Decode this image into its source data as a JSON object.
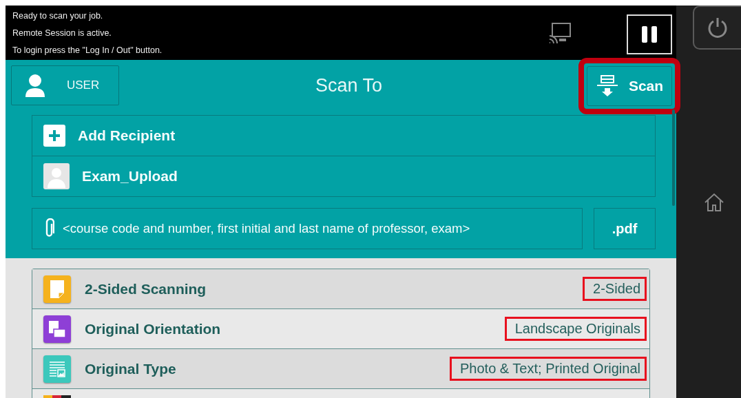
{
  "status_messages": [
    "Ready to scan your job.",
    "Remote Session is active.",
    "To login press the \"Log In / Out\" button."
  ],
  "header": {
    "user_label": "USER",
    "title": "Scan To",
    "scan_button": {
      "label": "Scan",
      "highlighted": true
    }
  },
  "recipients": [
    {
      "kind": "add",
      "label": "Add Recipient"
    },
    {
      "kind": "contact",
      "label": "Exam_Upload"
    }
  ],
  "file_name": {
    "value": "<course code and number, first initial and last name of professor, exam>",
    "format": ".pdf"
  },
  "settings": [
    {
      "kind": "sided",
      "label": "2-Sided Scanning",
      "value": "2-Sided",
      "highlighted": true
    },
    {
      "kind": "orientation",
      "label": "Original Orientation",
      "value": "Landscape Originals",
      "highlighted": true
    },
    {
      "kind": "type",
      "label": "Original Type",
      "value": "Photo & Text; Printed Original",
      "highlighted": true
    }
  ]
}
